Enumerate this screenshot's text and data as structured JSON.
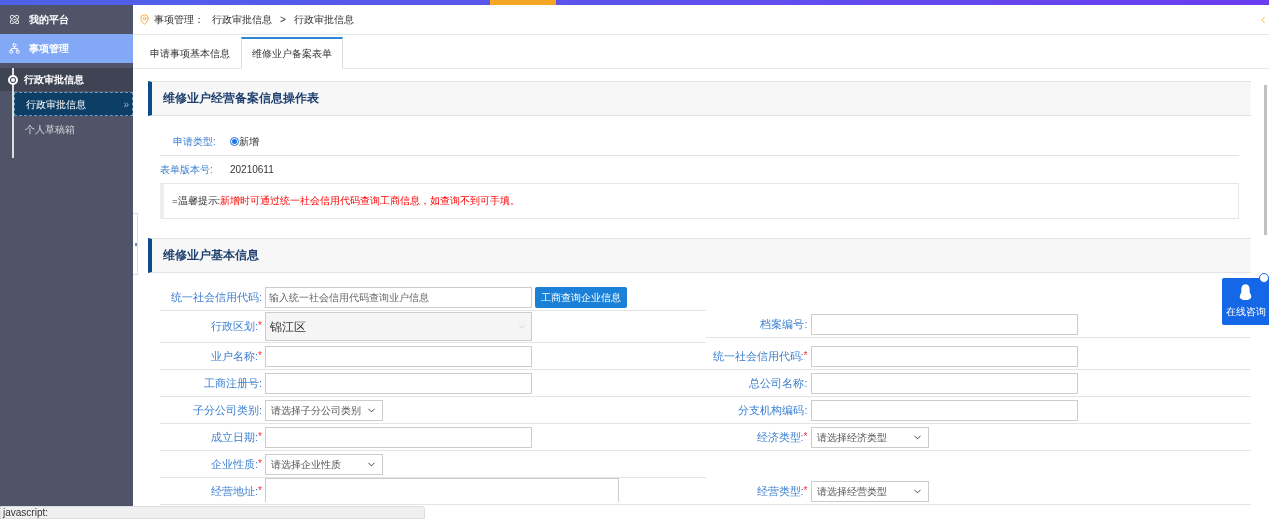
{
  "sidebar": {
    "items": [
      {
        "label": "我的平台",
        "selected": false
      },
      {
        "label": "事项管理",
        "selected": true
      }
    ],
    "tree": {
      "label": "行政审批信息",
      "expanded": true,
      "children": [
        {
          "label": "行政审批信息",
          "selected": true,
          "arrow": "»"
        },
        {
          "label": "个人草稿箱",
          "selected": false
        }
      ]
    }
  },
  "breadcrumb": {
    "root": "事项管理：",
    "items": [
      "行政审批信息",
      ">",
      "行政审批信息"
    ]
  },
  "tabs": [
    {
      "label": "申请事项基本信息",
      "selected": false
    },
    {
      "label": "维修业户备案表单",
      "selected": true
    }
  ],
  "section_1": {
    "title": "维修业户经营备案信息操作表",
    "application_type": {
      "label": "申请类型:",
      "options": [
        {
          "label": "新增",
          "selected": true
        }
      ]
    },
    "form_version": {
      "label": "表单版本号:",
      "value": "20210611"
    },
    "tip": {
      "label": "=温馨提示:",
      "text": "新增时可通过统一社会信用代码查询工商信息，如查询不到可手填。"
    }
  },
  "section_2": {
    "title": "维修业户基本信息",
    "rows": [
      {
        "left": {
          "label": "统一社会信用代码:",
          "kind": "search",
          "placeholder": "输入统一社会信用代码查询业户信息",
          "button": "工商查询企业信息"
        }
      },
      {
        "left": {
          "label": "行政区划:",
          "required_mark": "*",
          "kind": "select",
          "value": "锦江区",
          "disabled": true
        },
        "right": {
          "label": "档案编号:",
          "kind": "input"
        }
      },
      {
        "left": {
          "label": "业户名称:",
          "required_mark": "*",
          "kind": "input"
        },
        "right": {
          "label": "统一社会信用代码:",
          "required_mark": "*",
          "kind": "input"
        }
      },
      {
        "left": {
          "label": "工商注册号:",
          "kind": "input"
        },
        "right": {
          "label": "总公司名称:",
          "kind": "input"
        }
      },
      {
        "left": {
          "label": "子分公司类别:",
          "kind": "select",
          "value": "请选择子分公司类别",
          "disabled": false
        },
        "right": {
          "label": "分支机构编码:",
          "kind": "input"
        }
      },
      {
        "left": {
          "label": "成立日期:",
          "required_mark": "*",
          "kind": "input"
        },
        "right": {
          "label": "经济类型:",
          "required_mark": "*",
          "kind": "select",
          "value": "请选择经济类型",
          "disabled": false
        }
      },
      {
        "left": {
          "label": "企业性质:",
          "required_mark": "*",
          "kind": "select",
          "value": "请选择企业性质",
          "disabled": false
        }
      },
      {
        "left": {
          "label": "经营地址:",
          "required_mark": "*",
          "kind": "textarea"
        },
        "right": {
          "label": "经营类型:",
          "required_mark": "*",
          "kind": "select",
          "value": "请选择经营类型",
          "disabled": false
        }
      }
    ]
  },
  "chat_widget": {
    "label": "在线咨询"
  },
  "status_bar": {
    "text": "javascript:"
  }
}
